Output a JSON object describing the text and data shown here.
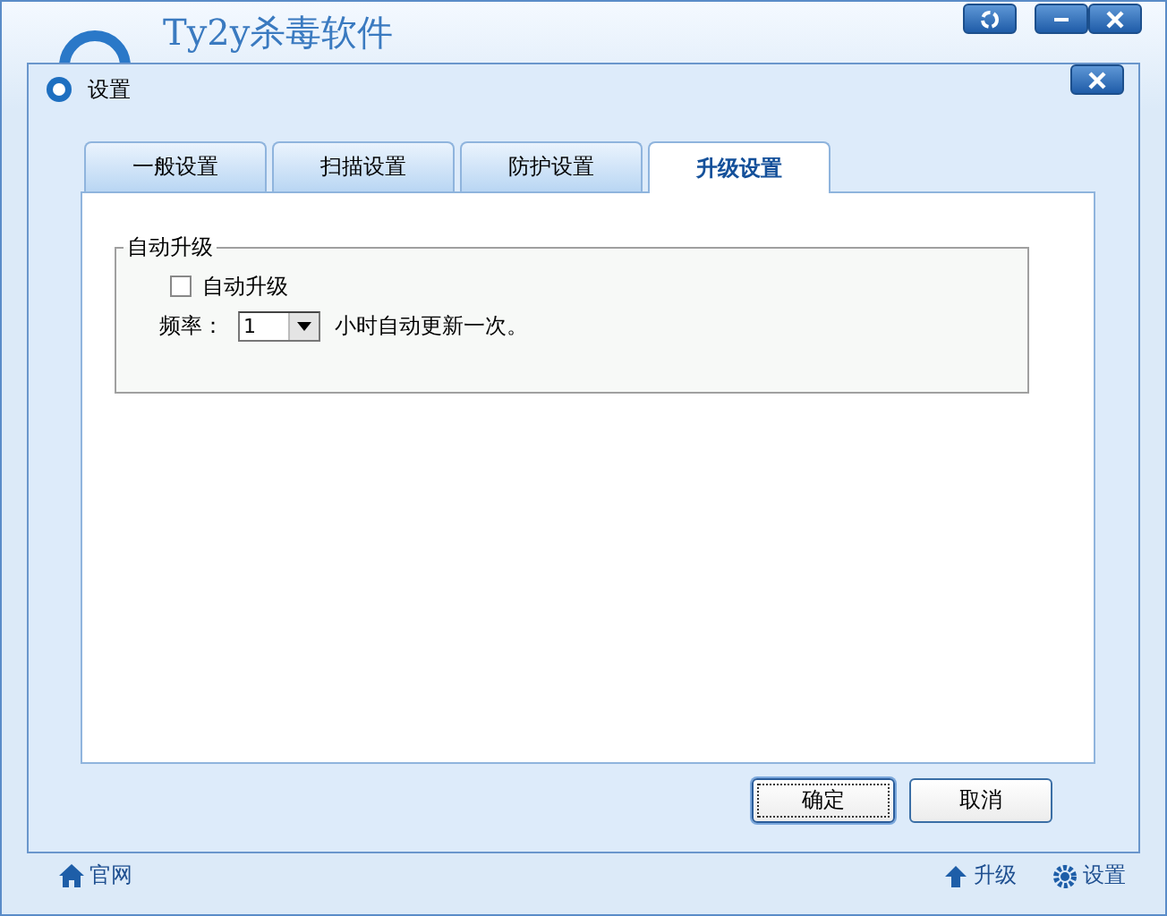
{
  "main_window": {
    "title": "Ty2y杀毒软件"
  },
  "dialog": {
    "title": "设置",
    "tabs": [
      {
        "label": "一般设置",
        "selected": false
      },
      {
        "label": "扫描设置",
        "selected": false
      },
      {
        "label": "防护设置",
        "selected": false
      },
      {
        "label": "升级设置",
        "selected": true
      }
    ],
    "group": {
      "title": "自动升级",
      "checkbox": {
        "label": "自动升级",
        "checked": false
      },
      "frequency_label": "频率：",
      "frequency_value": "1",
      "frequency_suffix": "小时自动更新一次。"
    },
    "buttons": [
      {
        "label": "确定",
        "default": true
      },
      {
        "label": "取消",
        "default": false
      }
    ]
  },
  "footer": {
    "website_link": "官网",
    "upgrade_link": "升级",
    "settings_link": "设置"
  }
}
